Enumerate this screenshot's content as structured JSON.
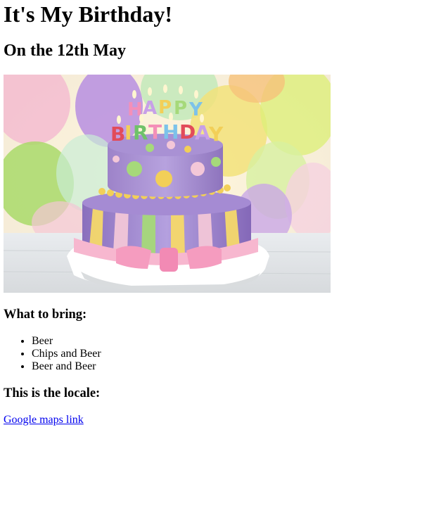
{
  "page": {
    "title": "It's My Birthday!",
    "subtitle": "On the 12th May",
    "image": {
      "icon": "birthday-cake-photo",
      "cake_topper_text": "HAPPY BIRTHDAY"
    },
    "bring": {
      "heading": "What to bring:",
      "items": [
        "Beer",
        "Chips and Beer",
        "Beer and Beer"
      ]
    },
    "locale": {
      "heading": "This is the locale:",
      "link_text": "Google maps link"
    }
  }
}
